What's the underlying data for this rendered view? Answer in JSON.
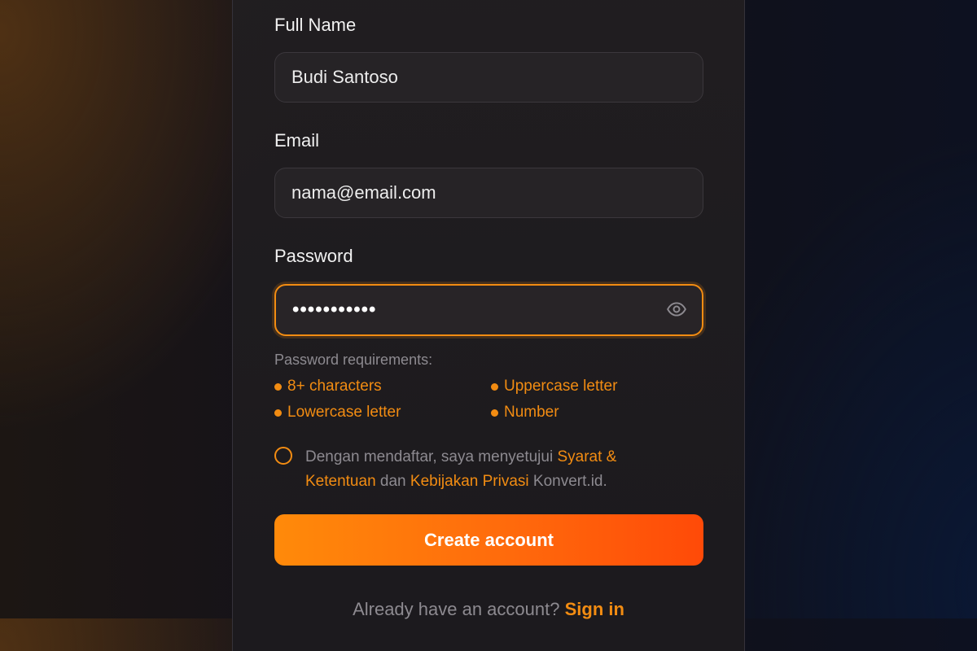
{
  "form": {
    "full_name_label": "Full Name",
    "full_name_value": "Budi Santoso",
    "email_label": "Email",
    "email_value": "nama@email.com",
    "password_label": "Password",
    "password_masked": "•••••••••••",
    "password_icon": "eye-icon"
  },
  "requirements": {
    "title": "Password requirements:",
    "items": [
      "8+ characters",
      "Uppercase letter",
      "Lowercase letter",
      "Number"
    ]
  },
  "terms": {
    "pre": "Dengan mendaftar, saya menyetujui ",
    "link1": "Syarat & Ketentuan",
    "mid": " dan ",
    "link2": "Kebijakan Privasi",
    "post": " Konvert.id."
  },
  "cta_label": "Create account",
  "signin": {
    "prompt": "Already have an account? ",
    "link": "Sign in"
  },
  "colors": {
    "accent": "#f28c12",
    "cta_start": "#ff8a0a",
    "cta_end": "#ff4a08"
  }
}
